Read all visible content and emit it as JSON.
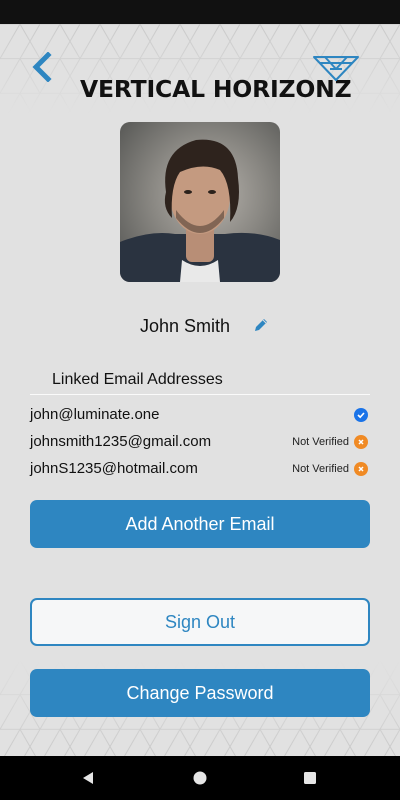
{
  "brand": {
    "name": "VERTICAL HORIZONZ",
    "logo_icon": "vh-triangle-logo-icon",
    "accent_color": "#2e86c1"
  },
  "header": {
    "back_icon": "chevron-left-icon"
  },
  "profile": {
    "avatar_icon": "profile-photo",
    "name": "John Smith",
    "edit_icon": "pencil-icon"
  },
  "emails": {
    "title": "Linked Email Addresses",
    "items": [
      {
        "address": "john@luminate.one",
        "status": "",
        "icon": "check-circle-icon",
        "color": "#1a73e8"
      },
      {
        "address": "johnsmith1235@gmail.com",
        "status": "Not Verified",
        "icon": "x-circle-icon",
        "color": "#f08a24"
      },
      {
        "address": "johnS1235@hotmail.com",
        "status": "Not Verified",
        "icon": "x-circle-icon",
        "color": "#f08a24"
      }
    ]
  },
  "buttons": {
    "add_email": "Add Another Email",
    "sign_out": "Sign Out",
    "change_password": "Change Password"
  },
  "nav": {
    "back_icon": "triangle-back-icon",
    "home_icon": "circle-home-icon",
    "recents_icon": "square-recents-icon"
  }
}
